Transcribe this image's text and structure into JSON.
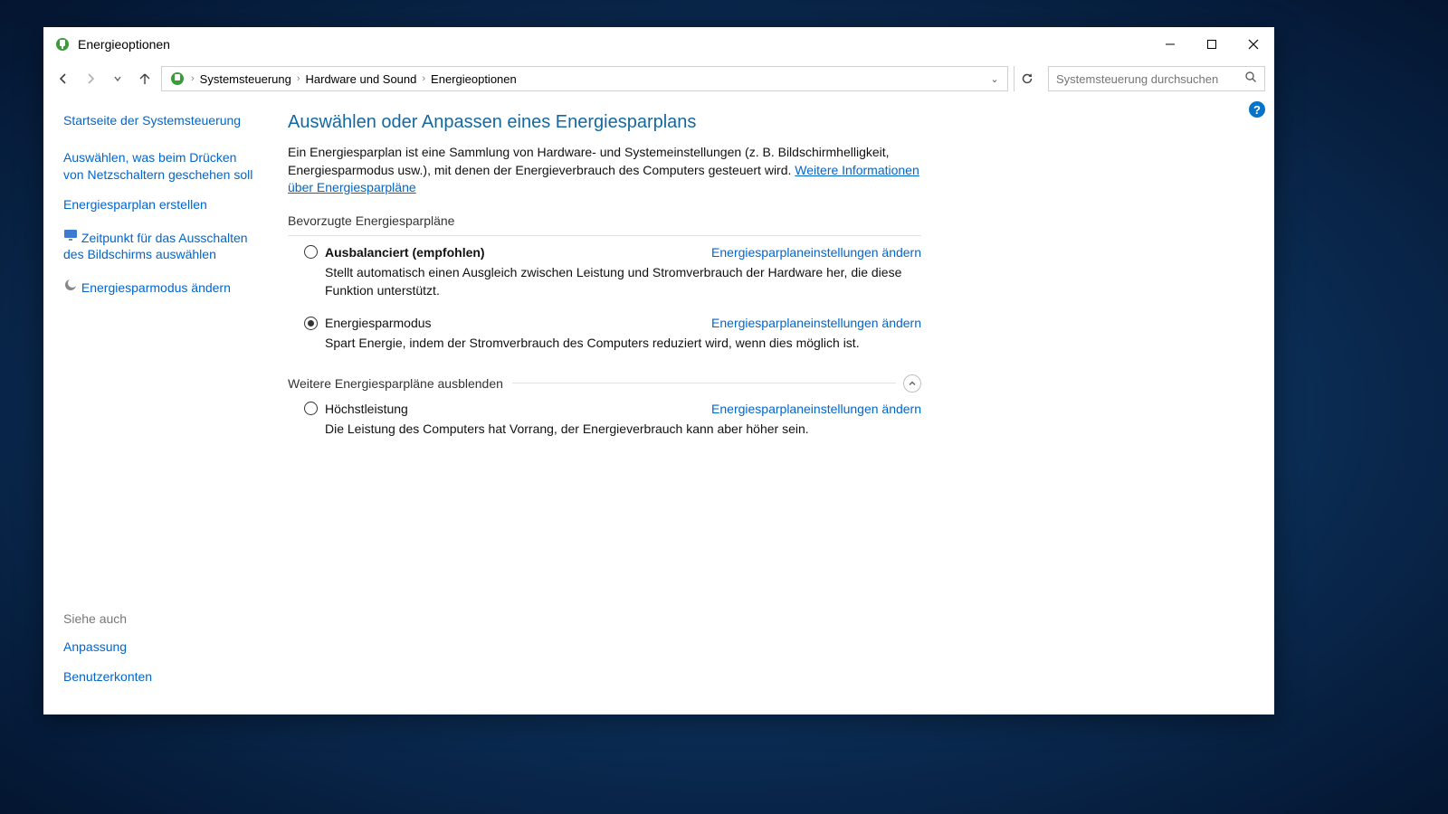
{
  "window": {
    "title": "Energieoptionen"
  },
  "breadcrumb": {
    "root": "Systemsteuerung",
    "mid": "Hardware und Sound",
    "leaf": "Energieoptionen"
  },
  "search": {
    "placeholder": "Systemsteuerung durchsuchen"
  },
  "sidebar": {
    "home": "Startseite der Systemsteuerung",
    "links": [
      "Auswählen, was beim Drücken von Netzschaltern geschehen soll",
      "Energiesparplan erstellen",
      "Zeitpunkt für das Ausschalten des Bildschirms auswählen",
      "Energiesparmodus ändern"
    ],
    "see_also_label": "Siehe auch",
    "see_also": [
      "Anpassung",
      "Benutzerkonten"
    ]
  },
  "main": {
    "title": "Auswählen oder Anpassen eines Energiesparplans",
    "intro_text": "Ein Energiesparplan ist eine Sammlung von Hardware- und Systemeinstellungen (z. B. Bildschirmhelligkeit, Energiesparmodus usw.), mit denen der Energieverbrauch des Computers gesteuert wird. ",
    "intro_link": "Weitere Informationen über Energiesparpläne",
    "preferred_label": "Bevorzugte Energiesparpläne",
    "additional_label": "Weitere Energiesparpläne ausblenden",
    "change_link": "Energiesparplaneinstellungen ändern",
    "plans": {
      "balanced": {
        "name": "Ausbalanciert (empfohlen)",
        "desc": "Stellt automatisch einen Ausgleich zwischen Leistung und Stromverbrauch der Hardware her, die diese Funktion unterstützt."
      },
      "saver": {
        "name": "Energiesparmodus",
        "desc": "Spart Energie, indem der Stromverbrauch des Computers reduziert wird, wenn dies möglich ist."
      },
      "high": {
        "name": "Höchstleistung",
        "desc": "Die Leistung des Computers hat Vorrang, der Energieverbrauch kann aber höher sein."
      }
    }
  }
}
